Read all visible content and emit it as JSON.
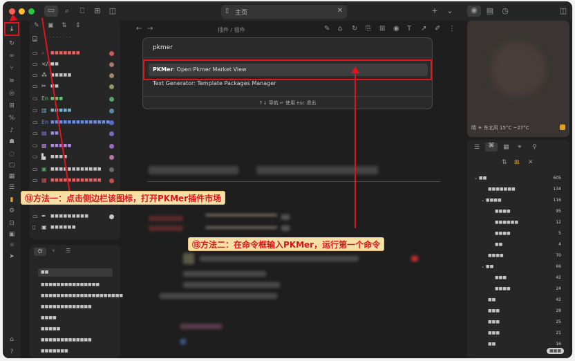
{
  "window": {
    "tab_title": "主页"
  },
  "main": {
    "breadcrumb": "插件 / 插件"
  },
  "command_palette": {
    "input_value": "pkmer",
    "items": [
      {
        "label_bold": "PKMer",
        "label_rest": ": Open Pkmer Market View"
      },
      {
        "label_bold": "",
        "label_rest": "Text Generator: Template Packages Manager"
      }
    ],
    "footer": "↑↓ 导航    ↵ 使用    esc 退出"
  },
  "annotations": {
    "method1": "⑬方法一：点击侧边栏该图标，打开PKMer插件市场",
    "method2": "⑬方法二：在命令框输入PKMer，运行第一个命令"
  },
  "weather": {
    "text": "晴 ☀ 东北风 15°C ~27°C"
  },
  "tags": {
    "counts": [
      "605",
      "134",
      "116",
      "95",
      "12",
      "5",
      "4",
      "70",
      "66",
      "42",
      "24",
      "42",
      "28",
      "25",
      "21",
      "16"
    ]
  },
  "colors": {
    "accent_red": "#e0141c",
    "note_bg": "#f6e0a6"
  }
}
